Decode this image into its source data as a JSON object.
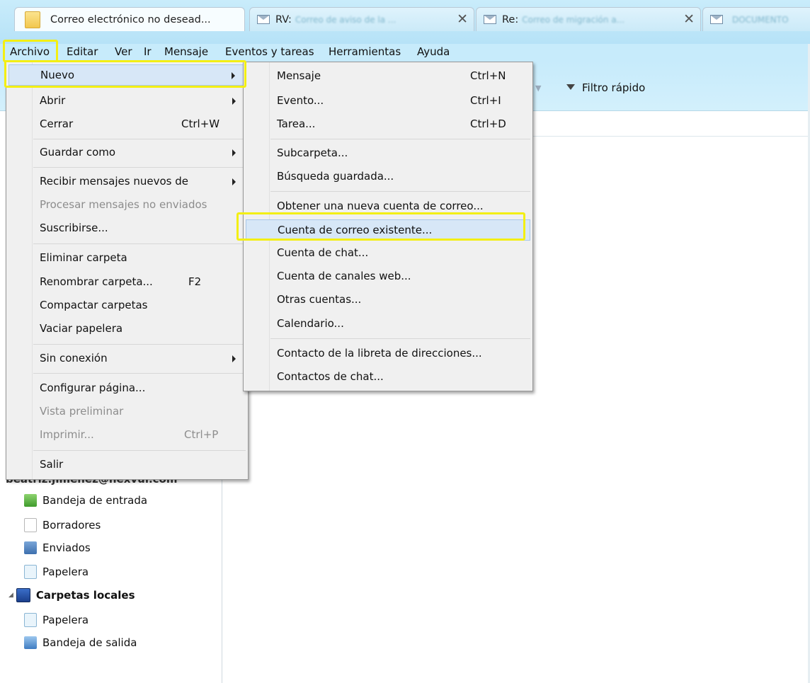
{
  "tabs": [
    {
      "label": "Correo electrónico no desead...",
      "blurred": ""
    },
    {
      "label": "RV:",
      "blurred": "Correo de aviso de la ..."
    },
    {
      "label": "Re:",
      "blurred": "Correo de migración a..."
    },
    {
      "label": "",
      "blurred": "DOCUMENTO"
    }
  ],
  "menubar": [
    "Archivo",
    "Editar",
    "Ver",
    "Ir",
    "Mensaje",
    "Eventos y tareas",
    "Herramientas",
    "Ayuda"
  ],
  "toolbar": {
    "quick_filter": "Filtro rápido"
  },
  "file_menu": [
    {
      "label": "Nuevo",
      "submenu": true
    },
    {
      "label": "Abrir",
      "submenu": true
    },
    {
      "label": "Cerrar",
      "shortcut": "Ctrl+W"
    },
    {
      "label": "Guardar como",
      "submenu": true
    },
    {
      "label": "Recibir mensajes nuevos de",
      "submenu": true
    },
    {
      "label": "Procesar mensajes no enviados",
      "disabled": true
    },
    {
      "label": "Suscribirse..."
    },
    {
      "label": "Eliminar carpeta"
    },
    {
      "label": "Renombrar carpeta...",
      "shortcut": "F2"
    },
    {
      "label": "Compactar carpetas"
    },
    {
      "label": "Vaciar papelera"
    },
    {
      "label": "Sin conexión",
      "submenu": true
    },
    {
      "label": "Configurar página..."
    },
    {
      "label": "Vista preliminar",
      "disabled": true
    },
    {
      "label": "Imprimir...",
      "shortcut": "Ctrl+P",
      "disabled": true
    },
    {
      "label": "Salir"
    }
  ],
  "new_submenu": [
    {
      "label": "Mensaje",
      "shortcut": "Ctrl+N"
    },
    {
      "label": "Evento...",
      "shortcut": "Ctrl+I"
    },
    {
      "label": "Tarea...",
      "shortcut": "Ctrl+D"
    },
    {
      "label": "Subcarpeta..."
    },
    {
      "label": "Búsqueda guardada..."
    },
    {
      "label": "Obtener una nueva cuenta de correo..."
    },
    {
      "label": "Cuenta de correo existente..."
    },
    {
      "label": "Cuenta de chat..."
    },
    {
      "label": "Cuenta de canales web..."
    },
    {
      "label": "Otras cuentas..."
    },
    {
      "label": "Calendario..."
    },
    {
      "label": "Contacto de la libreta de direcciones..."
    },
    {
      "label": "Contactos de chat..."
    }
  ],
  "folders": {
    "account": "beatriz.jimenez@nexvui.com",
    "account_items": [
      "Bandeja de entrada",
      "Borradores",
      "Enviados",
      "Papelera"
    ],
    "local": "Carpetas locales",
    "local_items": [
      "Papelera",
      "Bandeja de salida"
    ]
  },
  "colors": {
    "highlight_box": "#f3ef13",
    "menu_hover": "#d7e7f7",
    "toolbar": "#c7ebfb"
  }
}
